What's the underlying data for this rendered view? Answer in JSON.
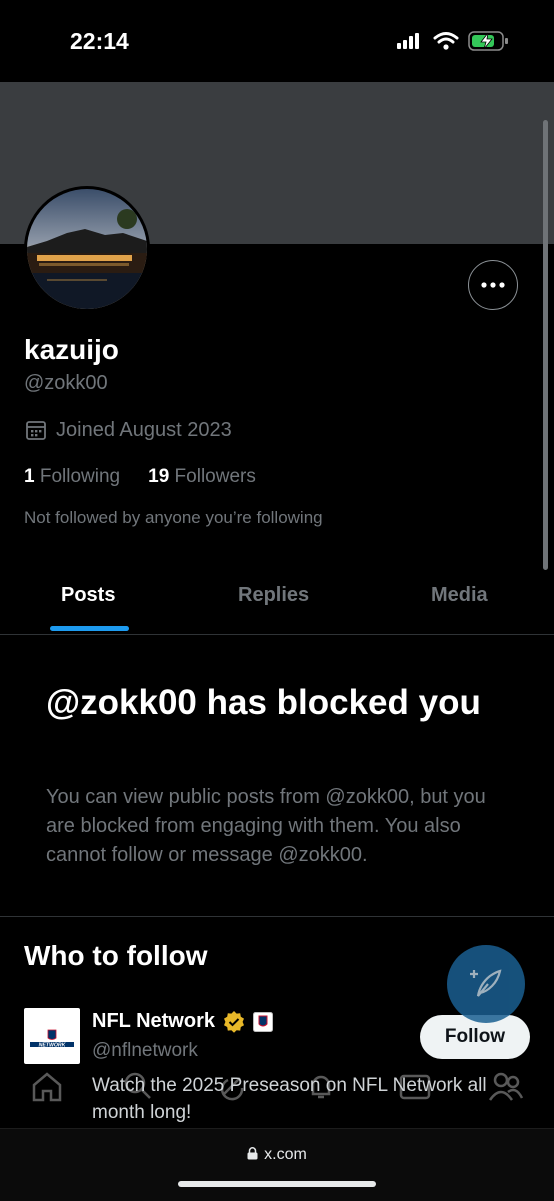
{
  "status_bar": {
    "time": "22:14"
  },
  "profile": {
    "name": "kazuijo",
    "handle": "@zokk00",
    "joined": "Joined August 2023",
    "following_count": "1",
    "following_label": "Following",
    "followers_count": "19",
    "followers_label": "Followers",
    "not_followed": "Not followed by anyone you’re following"
  },
  "tabs": [
    {
      "label": "Posts"
    },
    {
      "label": "Replies"
    },
    {
      "label": "Media"
    }
  ],
  "blocked": {
    "title": "@zokk00 has blocked you",
    "body": "You can view public posts from @zokk00, but you are blocked from engaging with them. You also cannot follow or message @zokk00."
  },
  "who_to_follow": {
    "title": "Who to follow",
    "suggestion": {
      "name": "NFL Network",
      "handle": "@nflnetwork",
      "bio": "Watch the 2025 Preseason on NFL Network all month long!",
      "follow_label": "Follow",
      "logo_text": "NETWORK"
    }
  },
  "browser": {
    "url": "x.com"
  },
  "colors": {
    "accent": "#1d9bf0",
    "verified_gold": "#e8b829",
    "background": "#000000"
  },
  "icons": [
    "signal-icon",
    "wifi-icon",
    "battery-icon",
    "more-icon",
    "calendar-icon",
    "compose-icon",
    "verified-badge-icon",
    "home-icon",
    "search-icon",
    "lock-icon"
  ]
}
